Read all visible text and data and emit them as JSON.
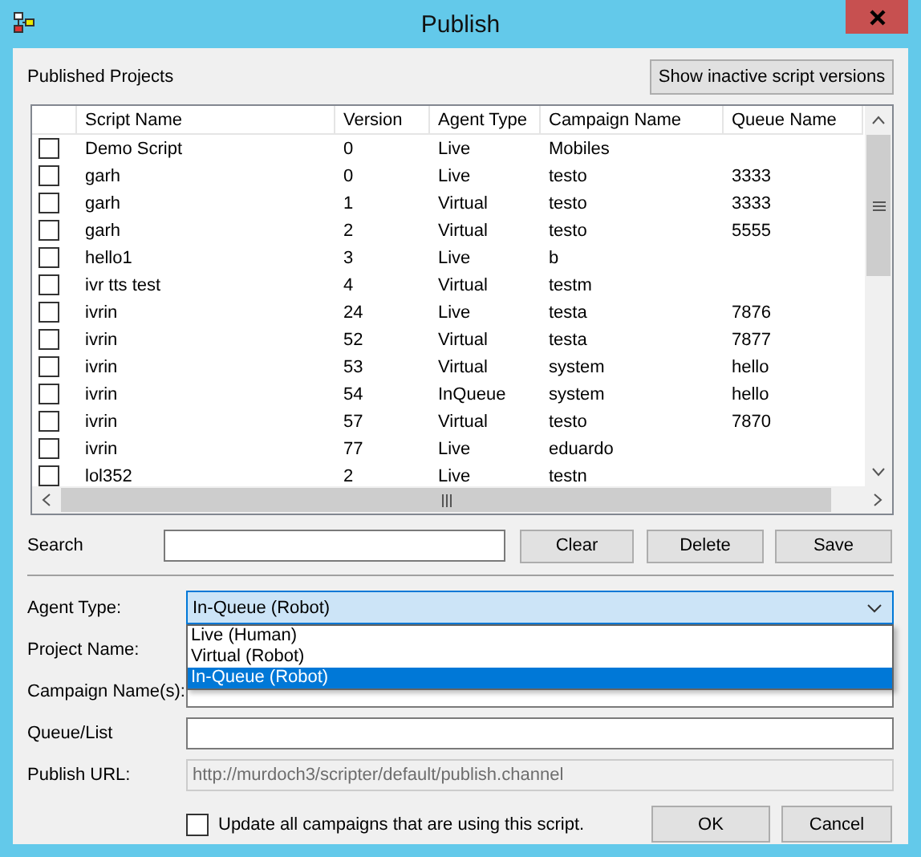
{
  "window": {
    "title": "Publish"
  },
  "published_projects": {
    "label": "Published Projects",
    "show_inactive_button": "Show inactive script versions"
  },
  "table": {
    "columns": [
      "Script Name",
      "Version",
      "Agent Type",
      "Campaign Name",
      "Queue Name"
    ],
    "rows": [
      {
        "checked": false,
        "cells": [
          "Demo Script",
          "0",
          "Live",
          "Mobiles",
          ""
        ]
      },
      {
        "checked": false,
        "cells": [
          "garh",
          "0",
          "Live",
          "testo",
          "3333"
        ]
      },
      {
        "checked": false,
        "cells": [
          "garh",
          "1",
          "Virtual",
          "testo",
          "3333"
        ]
      },
      {
        "checked": false,
        "cells": [
          "garh",
          "2",
          "Virtual",
          "testo",
          "5555"
        ]
      },
      {
        "checked": false,
        "cells": [
          "hello1",
          "3",
          "Live",
          "b",
          ""
        ]
      },
      {
        "checked": false,
        "cells": [
          "ivr tts test",
          "4",
          "Virtual",
          "testm",
          ""
        ]
      },
      {
        "checked": false,
        "cells": [
          "ivrin",
          "24",
          "Live",
          "testa",
          "7876"
        ]
      },
      {
        "checked": false,
        "cells": [
          "ivrin",
          "52",
          "Virtual",
          "testa",
          "7877"
        ]
      },
      {
        "checked": false,
        "cells": [
          "ivrin",
          "53",
          "Virtual",
          "system",
          "hello"
        ]
      },
      {
        "checked": false,
        "cells": [
          "ivrin",
          "54",
          "InQueue",
          "system",
          "hello"
        ]
      },
      {
        "checked": false,
        "cells": [
          "ivrin",
          "57",
          "Virtual",
          "testo",
          "7870"
        ]
      },
      {
        "checked": false,
        "cells": [
          "ivrin",
          "77",
          "Live",
          "eduardo",
          ""
        ]
      },
      {
        "checked": false,
        "cells": [
          "lol352",
          "2",
          "Live",
          "testn",
          ""
        ]
      }
    ]
  },
  "search": {
    "label": "Search",
    "buttons": [
      "Clear",
      "Delete",
      "Save"
    ]
  },
  "form": {
    "agent_type": {
      "label": "Agent Type:",
      "value": "In-Queue (Robot)",
      "expanded": true,
      "options": [
        {
          "label": "Live (Human)",
          "selected": false
        },
        {
          "label": "Virtual (Robot)",
          "selected": false
        },
        {
          "label": "In-Queue (Robot)",
          "selected": true
        }
      ]
    },
    "project_name": {
      "label": "Project Name:"
    },
    "campaign_names": {
      "label": "Campaign Name(s):"
    },
    "queue_list": {
      "label": "Queue/List"
    },
    "publish_url": {
      "label": "Publish URL:",
      "value": "http://murdoch3/scripter/default/publish.channel",
      "disabled": true
    }
  },
  "update_campaigns": {
    "label": "Update all campaigns that are using this script.",
    "checked": false
  },
  "buttons": [
    "OK",
    "Cancel"
  ]
}
